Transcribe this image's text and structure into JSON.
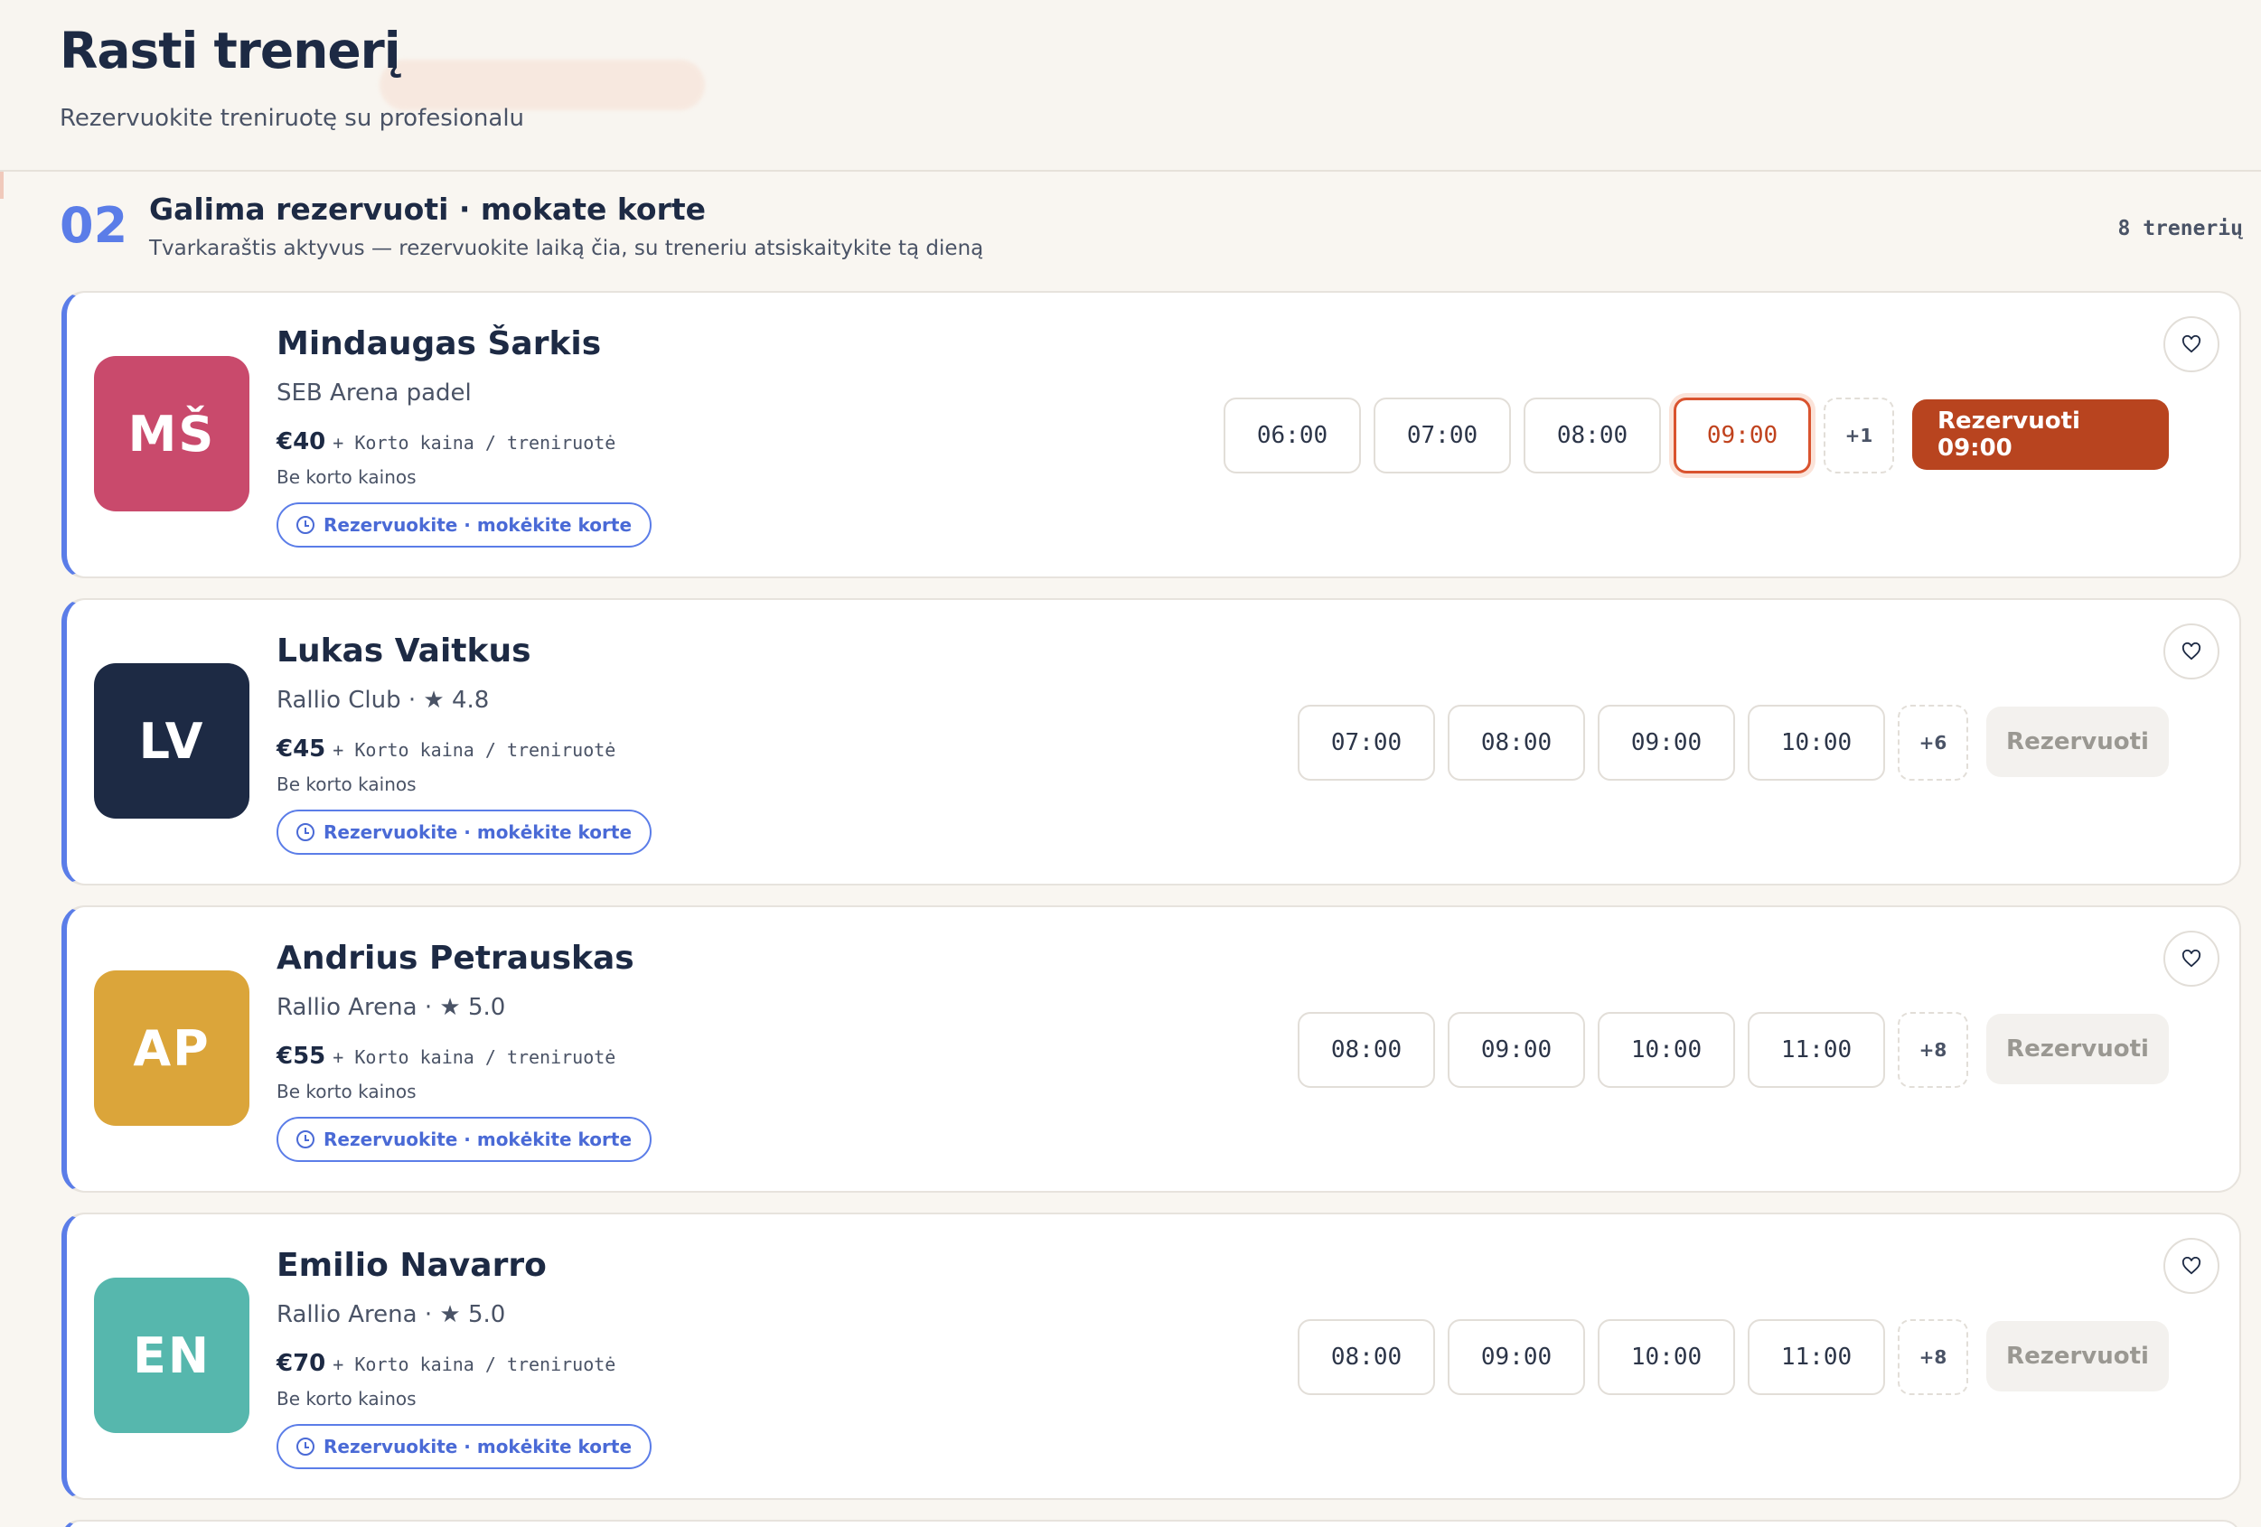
{
  "header": {
    "title": "Rasti trenerį",
    "subtitle": "Rezervuokite treniruotę su profesionalu"
  },
  "section": {
    "number": "02",
    "title": "Galima rezervuoti · mokate korte",
    "description": "Tvarkaraštis aktyvus — rezervuokite laiką čia, su treneriu atsiskaitykite tą dieną",
    "count": "8 trenerių"
  },
  "colors": {
    "accent": "#5b7de8",
    "primary_button": "#b8441f",
    "selected_slot": "#d9532f"
  },
  "trainers": [
    {
      "initials": "MŠ",
      "avatar_color": "#c94a6c",
      "name": "Mindaugas Šarkis",
      "venue": "SEB Arena padel",
      "price": "€40",
      "price_note": "+ Korto kaina / treniruotė",
      "court_note": "Be korto kainos",
      "badge": "Rezervuokite · mokėkite korte",
      "slots": [
        "06:00",
        "07:00",
        "08:00",
        "09:00"
      ],
      "selected_slot": "09:00",
      "more": "+1",
      "book_label": "Rezervuoti 09:00",
      "book_active": true
    },
    {
      "initials": "LV",
      "avatar_color": "#1d2a44",
      "name": "Lukas Vaitkus",
      "venue": "Rallio Club · ★ 4.8",
      "price": "€45",
      "price_note": "+ Korto kaina / treniruotė",
      "court_note": "Be korto kainos",
      "badge": "Rezervuokite · mokėkite korte",
      "slots": [
        "07:00",
        "08:00",
        "09:00",
        "10:00"
      ],
      "more": "+6",
      "book_label": "Rezervuoti",
      "book_active": false
    },
    {
      "initials": "AP",
      "avatar_color": "#dba53a",
      "name": "Andrius Petrauskas",
      "venue": "Rallio Arena · ★ 5.0",
      "price": "€55",
      "price_note": "+ Korto kaina / treniruotė",
      "court_note": "Be korto kainos",
      "badge": "Rezervuokite · mokėkite korte",
      "slots": [
        "08:00",
        "09:00",
        "10:00",
        "11:00"
      ],
      "more": "+8",
      "book_label": "Rezervuoti",
      "book_active": false
    },
    {
      "initials": "EN",
      "avatar_color": "#56b7ad",
      "name": "Emilio Navarro",
      "venue": "Rallio Arena · ★ 5.0",
      "price": "€70",
      "price_note": "+ Korto kaina / treniruotė",
      "court_note": "Be korto kainos",
      "badge": "Rezervuokite · mokėkite korte",
      "slots": [
        "08:00",
        "09:00",
        "10:00",
        "11:00"
      ],
      "more": "+8",
      "book_label": "Rezervuoti",
      "book_active": false
    }
  ],
  "icons": {
    "heart": "heart-icon",
    "clock": "clock-icon"
  }
}
